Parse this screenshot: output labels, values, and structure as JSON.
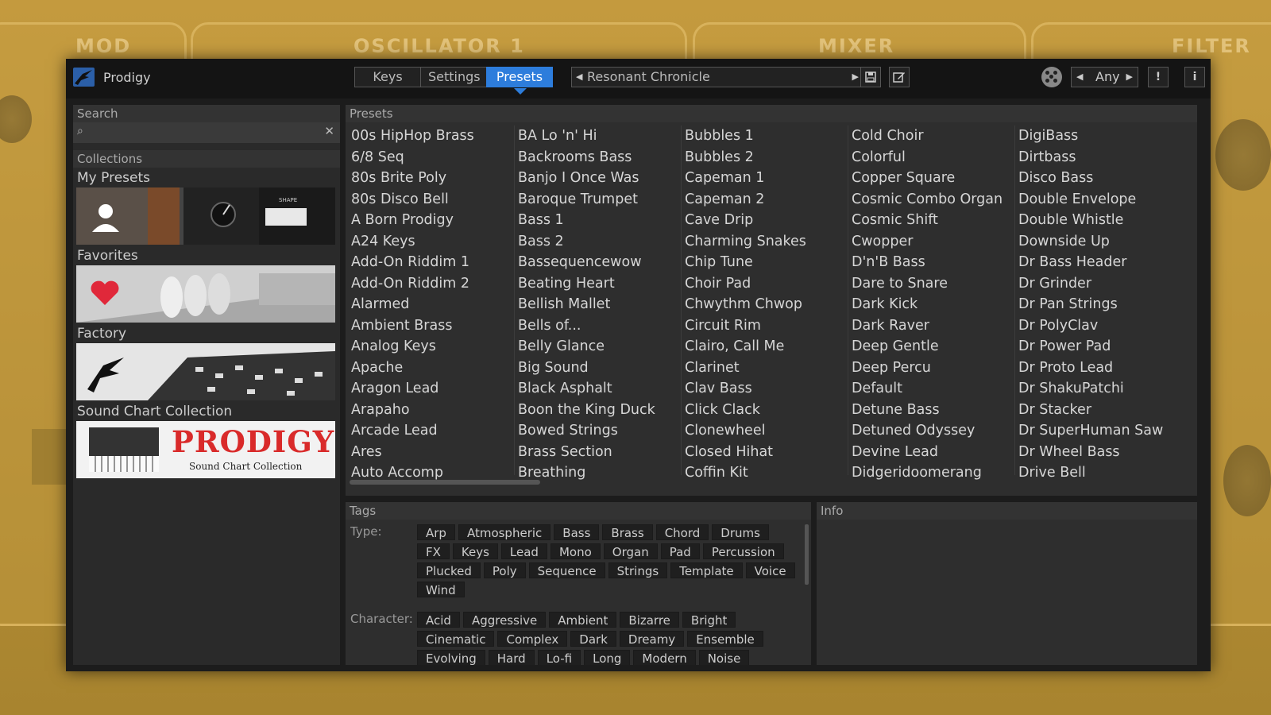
{
  "background": {
    "sections": [
      "MOD",
      "OSCILLATOR 1",
      "MIXER",
      "FILTER"
    ]
  },
  "app": {
    "title": "Prodigy"
  },
  "tabs": [
    {
      "label": "Keys",
      "active": false
    },
    {
      "label": "Settings",
      "active": false
    },
    {
      "label": "Presets",
      "active": true
    }
  ],
  "preset_nav": {
    "current": "Resonant Chronicle"
  },
  "filter_select": {
    "value": "Any"
  },
  "icons": {
    "save": "save-icon",
    "edit": "edit-icon",
    "dice": "dice-icon",
    "alert": "!",
    "info": "i"
  },
  "search": {
    "header": "Search",
    "placeholder": ""
  },
  "collections": {
    "header": "Collections",
    "items": [
      {
        "label": "My Presets"
      },
      {
        "label": "Favorites"
      },
      {
        "label": "Factory"
      },
      {
        "label": "Sound Chart Collection"
      }
    ],
    "banner_title": "PRODIGY",
    "banner_sub": "Sound Chart Collection"
  },
  "presets": {
    "header": "Presets",
    "columns": [
      [
        "00s HipHop Brass",
        "6/8 Seq",
        "80s Brite Poly",
        "80s Disco Bell",
        "A Born Prodigy",
        "A24 Keys",
        "Add-On Riddim 1",
        "Add-On Riddim 2",
        "Alarmed",
        "Ambient Brass",
        "Analog Keys",
        "Apache",
        "Aragon Lead",
        "Arapaho",
        "Arcade Lead",
        "Ares",
        "Auto Accomp"
      ],
      [
        "BA Lo 'n' Hi",
        "Backrooms Bass",
        "Banjo I Once Was",
        "Baroque Trumpet",
        "Bass 1",
        "Bass 2",
        "Bassequencewow",
        "Beating Heart",
        "Bellish Mallet",
        "Bells of...",
        "Belly Glance",
        "Big Sound",
        "Black Asphalt",
        "Boon the King Duck",
        "Bowed Strings",
        "Brass Section",
        "Breathing"
      ],
      [
        "Bubbles 1",
        "Bubbles 2",
        "Capeman 1",
        "Capeman 2",
        "Cave Drip",
        "Charming Snakes",
        "Chip Tune",
        "Choir Pad",
        "Chwythm Chwop",
        "Circuit Rim",
        "Clairo, Call Me",
        "Clarinet",
        "Clav Bass",
        "Click Clack",
        "Clonewheel",
        "Closed Hihat",
        "Coffin Kit"
      ],
      [
        "Cold Choir",
        "Colorful",
        "Copper Square",
        "Cosmic Combo Organ",
        "Cosmic Shift",
        "Cwopper",
        "D'n'B Bass",
        "Dare to Snare",
        "Dark Kick",
        "Dark Raver",
        "Deep Gentle",
        "Deep Percu",
        "Default",
        "Detune Bass",
        "Detuned Odyssey",
        "Devine Lead",
        "Didgeridoomerang"
      ],
      [
        "DigiBass",
        "Dirtbass",
        "Disco Bass",
        "Double Envelope",
        "Double Whistle",
        "Downside Up",
        "Dr Bass Header",
        "Dr Grinder",
        "Dr Pan Strings",
        "Dr PolyClav",
        "Dr Power Pad",
        "Dr Proto Lead",
        "Dr ShakuPatchi",
        "Dr Stacker",
        "Dr SuperHuman Saw",
        "Dr Wheel Bass",
        "Drive Bell"
      ]
    ]
  },
  "tags": {
    "header": "Tags",
    "type_label": "Type:",
    "type": [
      "Arp",
      "Atmospheric",
      "Bass",
      "Brass",
      "Chord",
      "Drums",
      "FX",
      "Keys",
      "Lead",
      "Mono",
      "Organ",
      "Pad",
      "Percussion",
      "Plucked",
      "Poly",
      "Sequence",
      "Strings",
      "Template",
      "Voice",
      "Wind"
    ],
    "character_label": "Character:",
    "character": [
      "Acid",
      "Aggressive",
      "Ambient",
      "Bizarre",
      "Bright",
      "Cinematic",
      "Complex",
      "Dark",
      "Dreamy",
      "Ensemble",
      "Evolving",
      "Hard",
      "Lo-fi",
      "Long",
      "Modern",
      "Noise"
    ]
  },
  "info": {
    "header": "Info"
  }
}
